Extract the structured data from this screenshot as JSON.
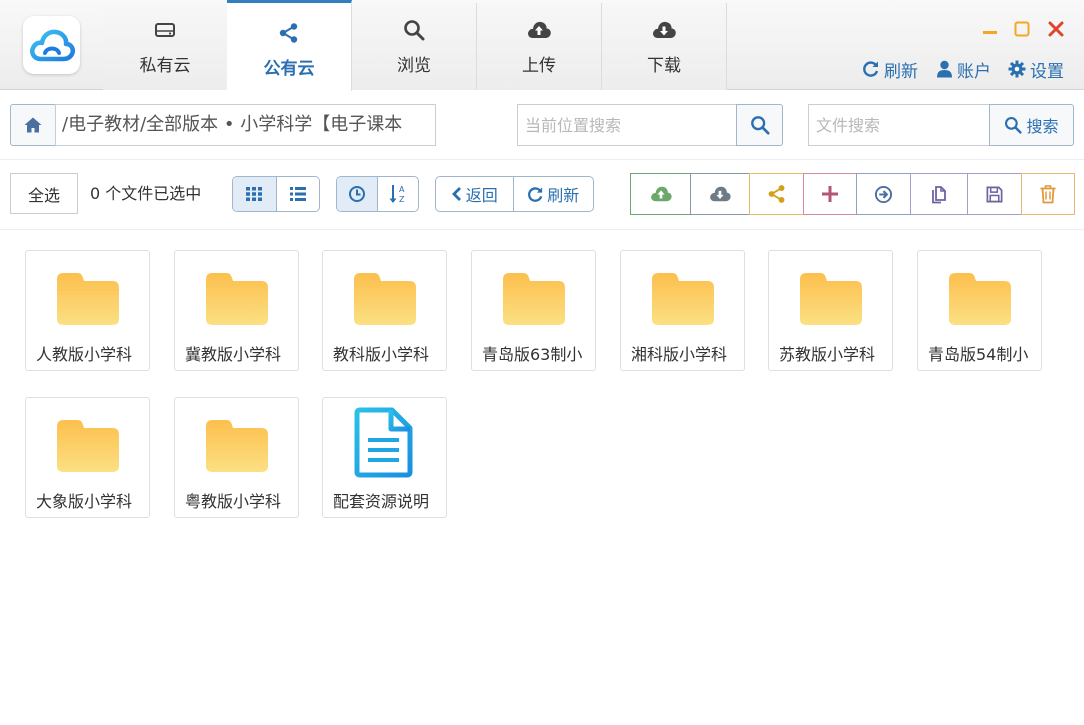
{
  "nav": {
    "tabs": [
      {
        "label": "私有云",
        "icon": "hard-drive-icon"
      },
      {
        "label": "公有云",
        "icon": "share-icon",
        "active": true
      },
      {
        "label": "浏览",
        "icon": "search-icon"
      },
      {
        "label": "上传",
        "icon": "cloud-upload-icon"
      },
      {
        "label": "下载",
        "icon": "cloud-download-icon"
      }
    ]
  },
  "header": {
    "refresh_label": "刷新",
    "account_label": "账户",
    "settings_label": "设置",
    "minimize_color": "#f5a623",
    "maximize_color": "#f5a623",
    "close_color": "#e0442c"
  },
  "pathbar": {
    "path": "/电子教材/全部版本 • 小学科学【电子课本",
    "location_search_placeholder": "当前位置搜索",
    "file_search_placeholder": "文件搜索",
    "search_label": "搜索"
  },
  "toolbar": {
    "select_all_label": "全选",
    "selection_count": "0 个文件已选中",
    "back_label": "返回",
    "refresh_label": "刷新",
    "operations": [
      {
        "icon": "cloud-upload-icon",
        "color": "#6ca86c"
      },
      {
        "icon": "cloud-download-icon",
        "color": "#6d7b87"
      },
      {
        "icon": "share-icon",
        "color": "#d4a017"
      },
      {
        "icon": "plus-icon",
        "color": "#b45673"
      },
      {
        "icon": "arrow-circle-right-icon",
        "color": "#4a6fa0"
      },
      {
        "icon": "copy-icon",
        "color": "#6f63a0"
      },
      {
        "icon": "save-icon",
        "color": "#6f63a0"
      },
      {
        "icon": "trash-icon",
        "color": "#e09a3e"
      }
    ]
  },
  "files": [
    {
      "name": "人教版小学科",
      "type": "folder"
    },
    {
      "name": "冀教版小学科",
      "type": "folder"
    },
    {
      "name": "教科版小学科",
      "type": "folder"
    },
    {
      "name": "青岛版63制小",
      "type": "folder"
    },
    {
      "name": "湘科版小学科",
      "type": "folder"
    },
    {
      "name": "苏教版小学科",
      "type": "folder"
    },
    {
      "name": "青岛版54制小",
      "type": "folder"
    },
    {
      "name": "大象版小学科",
      "type": "folder"
    },
    {
      "name": "粤教版小学科",
      "type": "folder"
    },
    {
      "name": "配套资源说明",
      "type": "document"
    }
  ]
}
